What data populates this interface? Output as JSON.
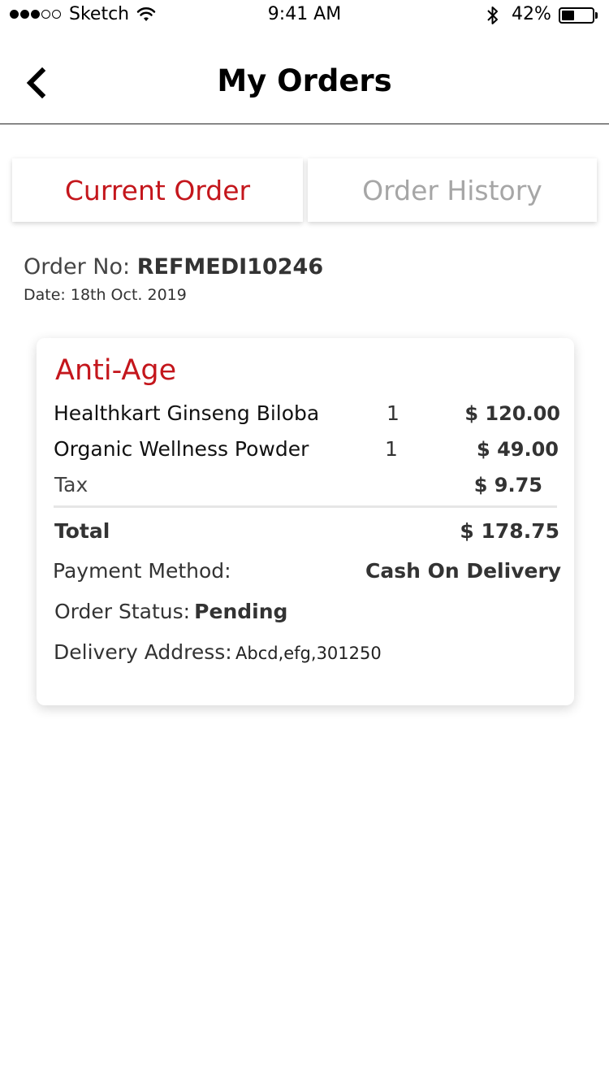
{
  "status_bar": {
    "carrier": "Sketch",
    "time": "9:41 AM",
    "battery_percent": "42%",
    "battery_level": 0.42,
    "signal_bars_filled": 3,
    "signal_bars_total": 5
  },
  "header": {
    "title": "My Orders",
    "back_icon": "chevron-left-icon"
  },
  "tabs": [
    {
      "label": "Current Order",
      "active": true
    },
    {
      "label": "Order History",
      "active": false
    }
  ],
  "order": {
    "number_label": "Order No:",
    "number": "REFMEDI10246",
    "date": "Date: 18th Oct. 2019",
    "category": "Anti-Age",
    "items": [
      {
        "name": "Healthkart Ginseng Biloba",
        "qty": "1",
        "price": "$ 120.00"
      },
      {
        "name": "Organic Wellness Powder",
        "qty": "1",
        "price": "$ 49.00"
      }
    ],
    "tax_label": "Tax",
    "tax": "$ 9.75",
    "total_label": "Total",
    "total": "$ 178.75",
    "payment_label": "Payment Method:",
    "payment_value": "Cash On Delivery",
    "status_label": "Order Status:",
    "status_value": "Pending",
    "address_label": "Delivery Address:",
    "address_value": "Abcd,efg,301250"
  },
  "colors": {
    "accent": "#c4161c",
    "inactive_tab": "#a6a6a6"
  }
}
